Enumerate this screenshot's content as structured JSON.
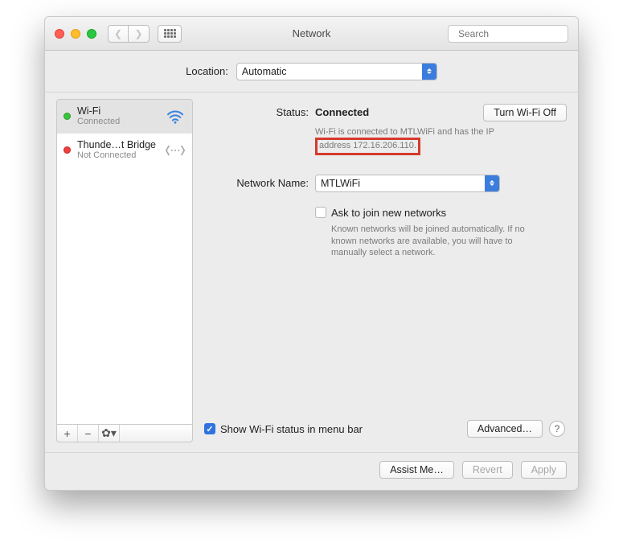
{
  "window": {
    "title": "Network"
  },
  "search": {
    "placeholder": "Search"
  },
  "location": {
    "label": "Location:",
    "value": "Automatic"
  },
  "sidebar": {
    "items": [
      {
        "name": "Wi-Fi",
        "status": "Connected",
        "state": "green",
        "icon": "wifi"
      },
      {
        "name": "Thunde…t Bridge",
        "status": "Not Connected",
        "state": "red",
        "icon": "thunderbolt"
      }
    ]
  },
  "detail": {
    "status_label": "Status:",
    "status_value": "Connected",
    "turn_off_label": "Turn Wi-Fi Off",
    "info_line1": "Wi-Fi is connected to MTLWiFi and has the IP",
    "info_line2": "address 172.16.206.110.",
    "network_name_label": "Network Name:",
    "network_name_value": "MTLWiFi",
    "ask_label": "Ask to join new networks",
    "ask_help": "Known networks will be joined automatically. If no known networks are available, you will have to manually select a network."
  },
  "footer": {
    "show_status_label": "Show Wi-Fi status in menu bar",
    "advanced_label": "Advanced…"
  },
  "buttons": {
    "assist": "Assist Me…",
    "revert": "Revert",
    "apply": "Apply"
  }
}
